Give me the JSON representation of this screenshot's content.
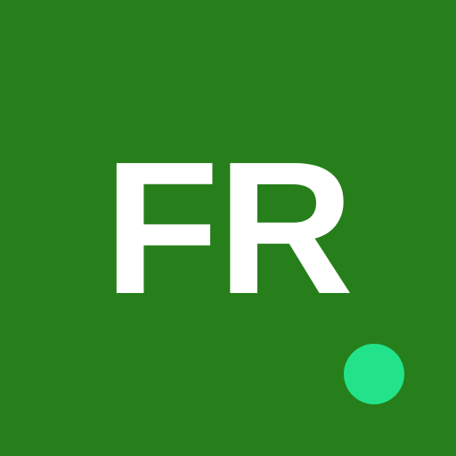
{
  "avatar": {
    "initials": "FR",
    "background_color": "#267f1b",
    "text_color": "#ffffff"
  },
  "status": {
    "indicator": "online-dot",
    "color": "#22e38a"
  }
}
